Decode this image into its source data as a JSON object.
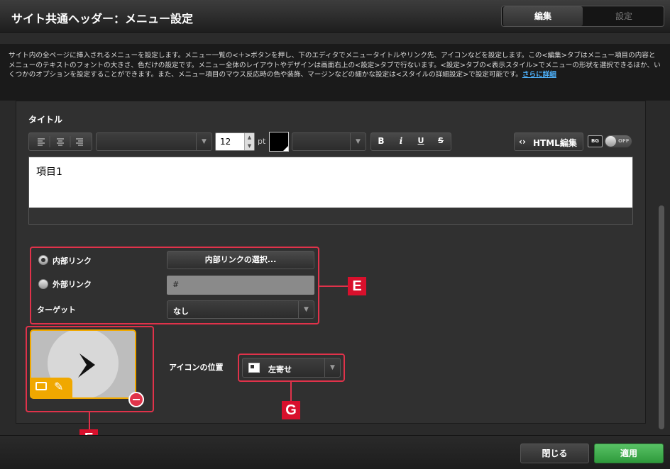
{
  "header": {
    "title": "サイト共通ヘッダー：メニュー設定",
    "tabs": [
      {
        "label": "編集"
      },
      {
        "label": "設定"
      }
    ]
  },
  "description": {
    "text": "サイト内の全ページに挿入されるメニューを設定します。メニュー一覧の<＋>ボタンを押し、下のエディタでメニュータイトルやリンク先、アイコンなどを設定します。この<編集>タブはメニュー項目の内容とメニューのテキストのフォントの大きさ、色だけの設定です。メニュー全体のレイアウトやデザインは画面右上の<設定>タブで行ないます。<設定>タブの<表示スタイル>でメニューの形状を選択できるほか、いくつかのオプションを設定することができます。また、メニュー項目のマウス反応時の色や装飾、マージンなどの細かな設定は<スタイルの詳細設定>で設定可能です。",
    "link": "さらに詳細"
  },
  "editor": {
    "title_label": "タイトル",
    "font_size": "12",
    "font_unit": "pt",
    "html_button": "HTML編集",
    "bg_label": "BG",
    "toggle_label": "OFF",
    "content": "項目1"
  },
  "link": {
    "internal_label": "内部リンク",
    "internal_button": "内部リンクの選択...",
    "external_label": "外部リンク",
    "external_value": "#",
    "target_label": "ターゲット",
    "target_value": "なし"
  },
  "icon": {
    "position_label": "アイコンの位置",
    "position_value": "左寄せ"
  },
  "callouts": {
    "e": "E",
    "f": "F",
    "g": "G"
  },
  "footer": {
    "close": "閉じる",
    "apply": "適用"
  },
  "colors": {
    "accent_red": "#d8102c",
    "apply_green": "#3caa4a",
    "icon_frame": "#f0a800"
  }
}
